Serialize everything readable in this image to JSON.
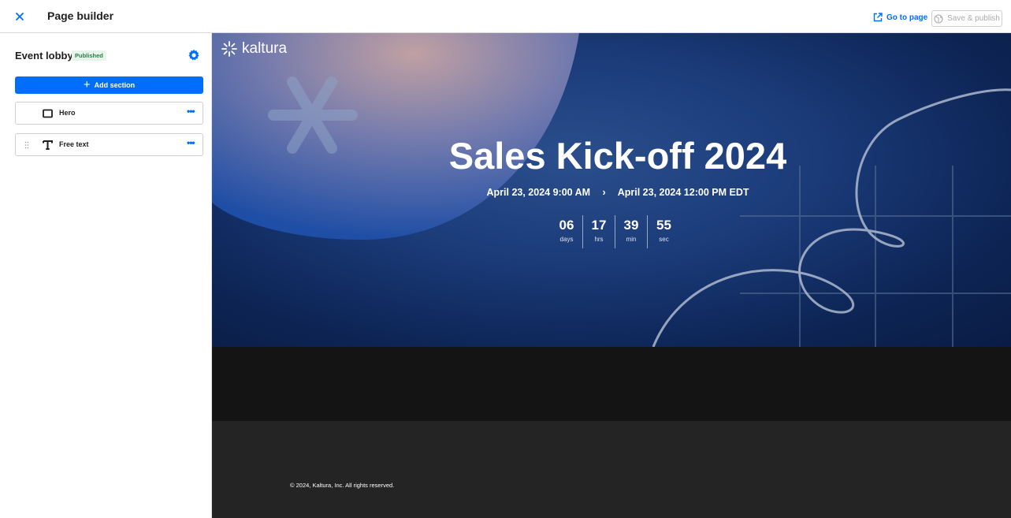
{
  "topbar": {
    "title": "Page builder",
    "go_to_page": "Go to page",
    "save_publish": "Save & publish"
  },
  "sidebar": {
    "page_name": "Event lobby",
    "status": "Published",
    "add_section": "Add section",
    "sections": [
      {
        "label": "Hero",
        "icon": "hero-section-icon"
      },
      {
        "label": "Free text",
        "icon": "text-t-icon"
      }
    ],
    "more_label": "•••"
  },
  "preview": {
    "logo_text": "kaltura",
    "title": "Sales Kick-off 2024",
    "start": "April 23, 2024 9:00 AM",
    "arrow": "›",
    "end": "April 23, 2024 12:00 PM EDT",
    "countdown": [
      {
        "value": "06",
        "unit": "days"
      },
      {
        "value": "17",
        "unit": "hrs"
      },
      {
        "value": "39",
        "unit": "min"
      },
      {
        "value": "55",
        "unit": "sec"
      }
    ],
    "copyright": "© 2024, Kaltura, Inc. All rights reserved."
  },
  "colors": {
    "accent": "#006efa",
    "badge_bg": "#e6f4ea",
    "badge_text": "#2d7d46",
    "hero_bg": "#1a3a78",
    "free_text_bg": "#141414",
    "footer_bg": "#242424"
  }
}
